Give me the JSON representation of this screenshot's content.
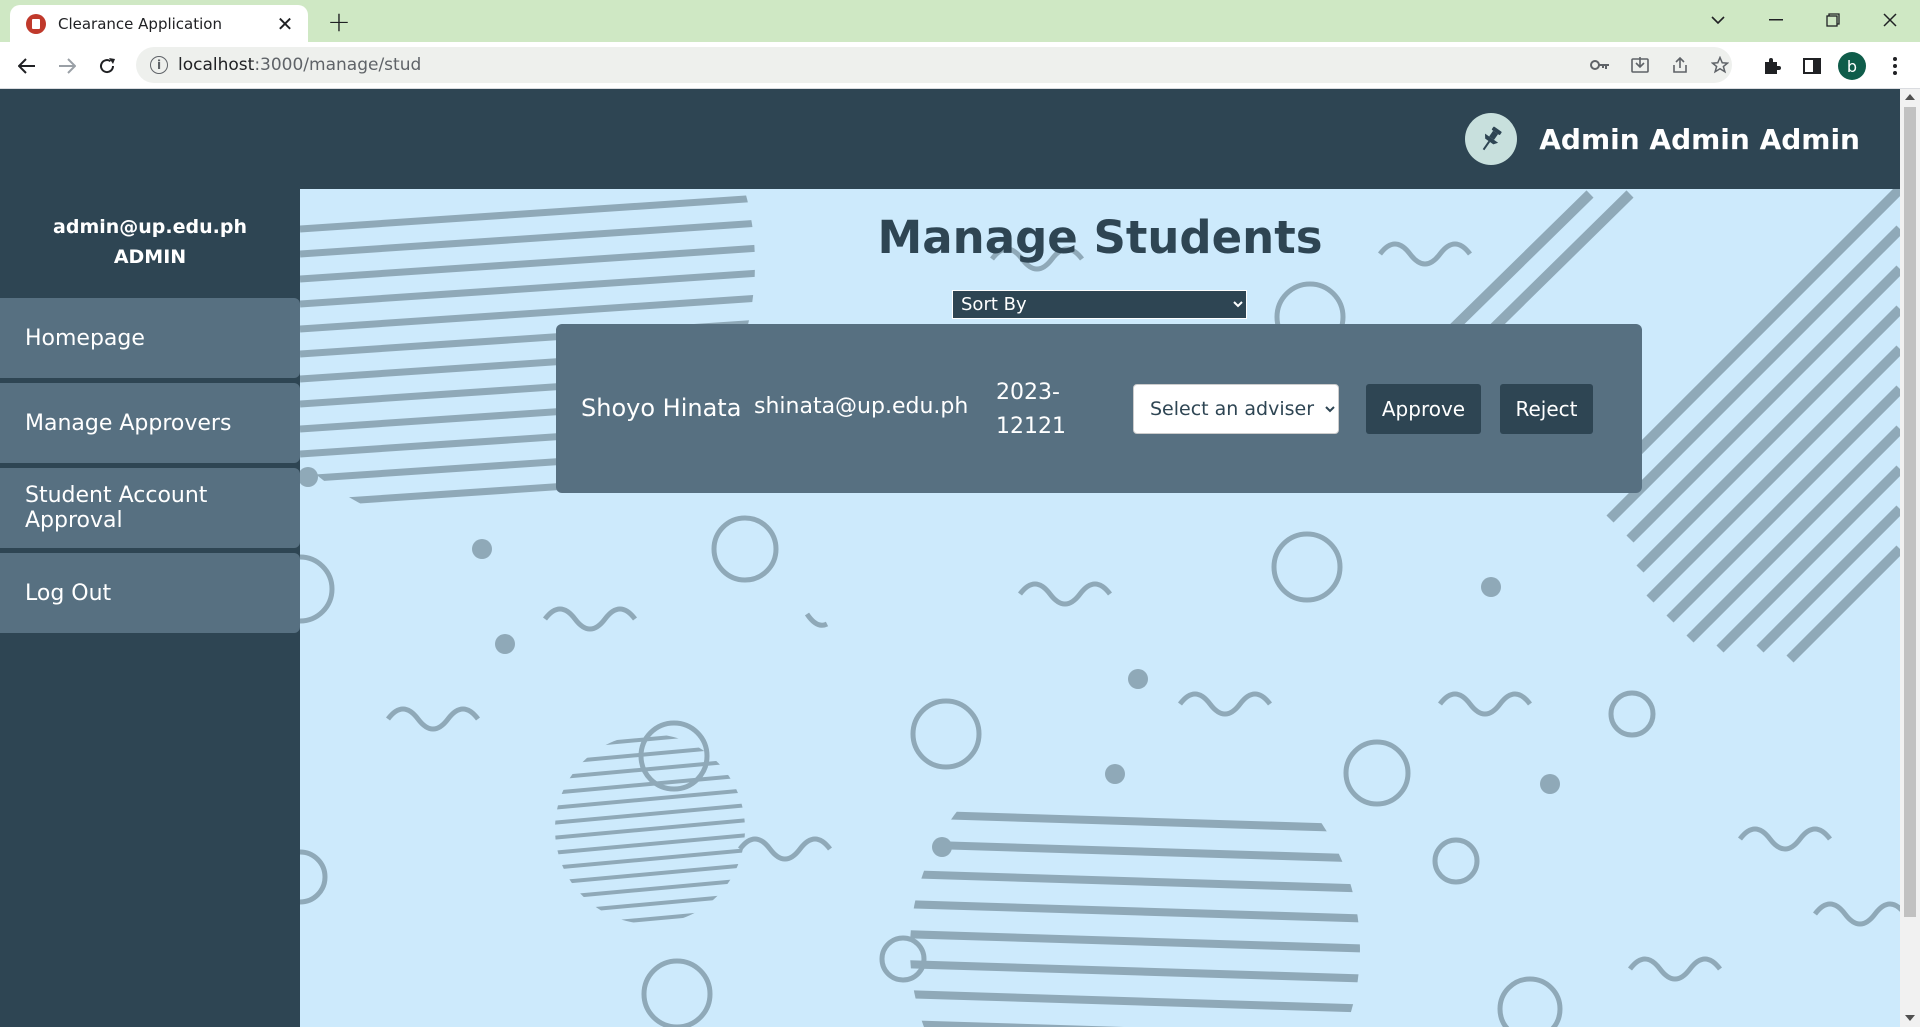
{
  "browser": {
    "tab_title": "Clearance Application",
    "tab_close": "✕",
    "new_tab": "+",
    "url_host": "localhost",
    "url_path": ":3000/manage/stud",
    "profile_initial": "b",
    "icons": [
      "back-icon",
      "forward-icon",
      "reload-icon",
      "info-icon",
      "key-icon",
      "install-icon",
      "share-icon",
      "star-icon",
      "extensions-icon",
      "side-panel-icon",
      "menu-icon"
    ]
  },
  "header": {
    "user_name": "Admin Admin Admin",
    "badge_icon": "pushpin-icon"
  },
  "sidebar": {
    "email": "admin@up.edu.ph",
    "role": "ADMIN",
    "items": [
      {
        "label": "Homepage"
      },
      {
        "label": "Manage Approvers"
      },
      {
        "label": "Student Account Approval"
      },
      {
        "label": "Log Out"
      }
    ]
  },
  "main": {
    "title": "Manage Students",
    "sort_label": "Sort By",
    "students": [
      {
        "name": "Shoyo Hinata",
        "email": "shinata@up.edu.ph",
        "student_number_line1": "2023-",
        "student_number_line2": "12121",
        "adviser_placeholder": "Select an adviser",
        "approve_label": "Approve",
        "reject_label": "Reject"
      }
    ]
  },
  "colors": {
    "sidebar_bg": "#2e4553",
    "nav_item_bg": "#577081",
    "main_bg": "#cdeafc",
    "pattern": "#8fa9b8",
    "tabstrip": "#cfe8c4"
  }
}
